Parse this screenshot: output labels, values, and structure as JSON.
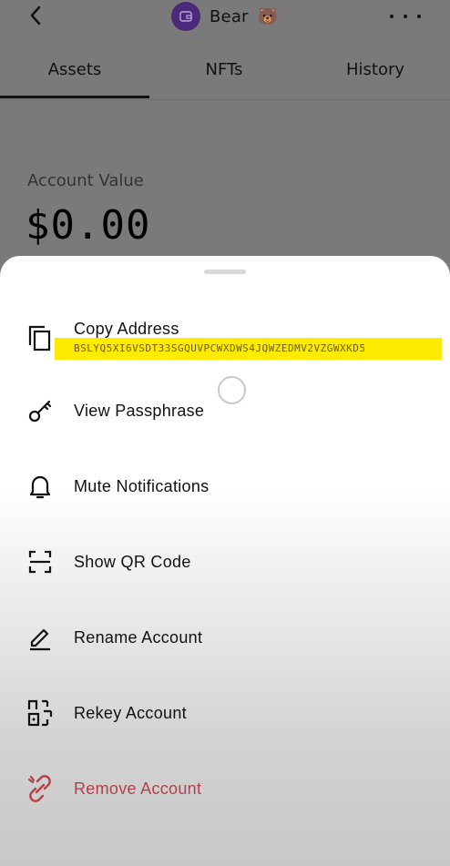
{
  "header": {
    "account_name": "Bear",
    "emoji": "🐻"
  },
  "tabs": [
    {
      "label": "Assets",
      "active": true
    },
    {
      "label": "NFTs",
      "active": false
    },
    {
      "label": "History",
      "active": false
    }
  ],
  "account_value": {
    "label": "Account Value",
    "amount": "$0.00"
  },
  "sheet": {
    "copy_address": {
      "label": "Copy Address",
      "address": "BSLYQ5XI6VSDT33SGQUVPCWXDWS4JQWZEDMV2VZGWXKD5",
      "icon": "copy-icon"
    },
    "items": [
      {
        "label": "View Passphrase",
        "icon": "key-icon"
      },
      {
        "label": "Mute Notifications",
        "icon": "bell-icon"
      },
      {
        "label": "Show QR Code",
        "icon": "qr-code-icon"
      },
      {
        "label": "Rename Account",
        "icon": "pencil-icon"
      },
      {
        "label": "Rekey Account",
        "icon": "rekey-icon"
      },
      {
        "label": "Remove Account",
        "icon": "unlink-icon"
      }
    ]
  },
  "colors": {
    "highlight": "#ffeb00",
    "danger": "#b5404a",
    "avatar": "#4b2a7a"
  }
}
